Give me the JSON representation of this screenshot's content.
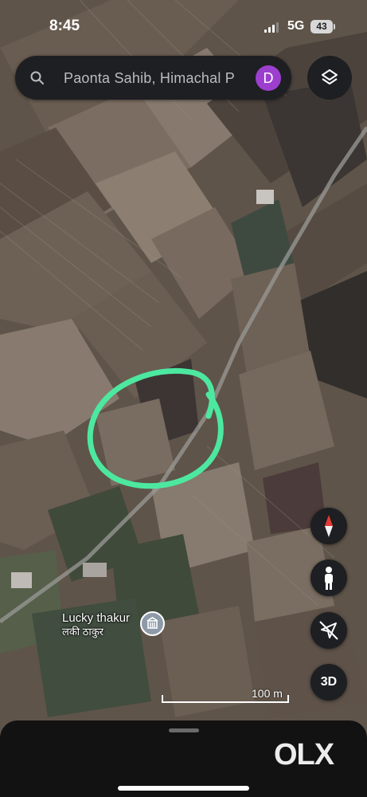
{
  "status_bar": {
    "time": "8:45",
    "network": "5G",
    "battery": "43"
  },
  "search": {
    "query": "Paonta Sahib, Himachal P",
    "avatar_initial": "D"
  },
  "map": {
    "type": "satellite",
    "place_label": {
      "name": "Lucky thakur",
      "name_local": "लकी ठाकुर"
    },
    "scale": "100 m",
    "highlight_color": "#4de8a0"
  },
  "controls": {
    "three_d_label": "3D"
  },
  "watermark": "OLX",
  "colors": {
    "ui_dark": "#1e1f22",
    "avatar": "#9c3fcf",
    "compass_red": "#e53935"
  }
}
